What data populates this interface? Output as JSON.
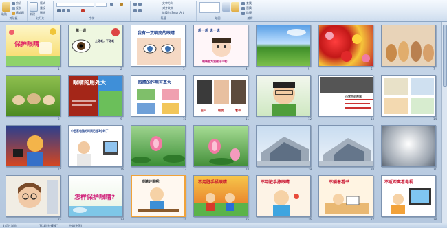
{
  "ribbon": {
    "groups": [
      {
        "label": "剪贴板",
        "name": "clipboard-group"
      },
      {
        "label": "幻灯片",
        "name": "slides-group"
      },
      {
        "label": "字体",
        "name": "font-group"
      },
      {
        "label": "段落",
        "name": "paragraph-group"
      },
      {
        "label": "绘图",
        "name": "drawing-group"
      },
      {
        "label": "编辑",
        "name": "editing-group"
      }
    ],
    "paste_label": "粘贴",
    "cut_label": "剪切",
    "copy_label": "复制",
    "format_painter_label": "格式刷",
    "new_slide_label": "新建",
    "layout_label": "版式",
    "reset_label": "重设",
    "delete_label": "删除",
    "text_direction_label": "文字方向",
    "align_text_label": "对齐文本",
    "smartart_label": "转换为 SmartArt",
    "find_label": "查找",
    "replace_label": "替换",
    "select_label": "选择"
  },
  "slides": [
    {
      "n": "1",
      "title": "保护眼睛"
    },
    {
      "n": "2",
      "title": "第一课",
      "sub": "上动毛，下动毛"
    },
    {
      "n": "3",
      "title": "我有一双明亮的眼睛"
    },
    {
      "n": "4",
      "title": "想一想 说一说",
      "sub": "眼睛能为我做什么呢?"
    },
    {
      "n": "5"
    },
    {
      "n": "6"
    },
    {
      "n": "7"
    },
    {
      "n": "8"
    },
    {
      "n": "9",
      "title": "眼睛的用处大"
    },
    {
      "n": "10",
      "title": "眼睛的作用可真大"
    },
    {
      "n": "11",
      "caps": [
        "盲人",
        "眼镜",
        "看书"
      ]
    },
    {
      "n": "12"
    },
    {
      "n": "13",
      "sub": "小学生近视率"
    },
    {
      "n": "14"
    },
    {
      "n": "15"
    },
    {
      "n": "16",
      "sub": "小丑家电脑的时间已超3小时了!"
    },
    {
      "n": "17"
    },
    {
      "n": "18"
    },
    {
      "n": "19"
    },
    {
      "n": "20"
    },
    {
      "n": "21"
    },
    {
      "n": "22"
    },
    {
      "n": "23",
      "title": "怎样保护眼睛?"
    },
    {
      "n": "24",
      "title": "眼睛好累啊!"
    },
    {
      "n": "25",
      "title": "不用脏手揉眼睛"
    },
    {
      "n": "26",
      "title": "不用脏手擦眼睛"
    },
    {
      "n": "27",
      "title": "不躺着看书"
    },
    {
      "n": "28",
      "title": "不近距离看电视"
    }
  ],
  "status": {
    "slide_label": "幻灯片浏览",
    "theme_label": "\"默认设计模板\"",
    "lang_label": "中文(中国)"
  },
  "colors": {
    "ribbon_bg": "#dfe9f5",
    "sorter_bg": "#c0d1e5",
    "slide_border": "#7d93b0"
  }
}
